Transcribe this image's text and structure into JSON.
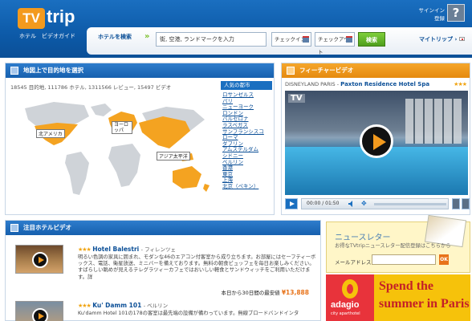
{
  "header": {
    "logo_tv": "TV",
    "logo_trip": "trip",
    "logo_sub": "ホテル　ビデオガイド",
    "signin": "サインイン",
    "register": "登録",
    "help": "?",
    "search_label": "ホテルを検索",
    "search_placeholder": "街, 空港, ランドマークを入力",
    "checkin": "チェックイン",
    "checkout": "チェックアウト",
    "search_button": "検索",
    "mytrip": "マイトリップ"
  },
  "map_panel": {
    "title": "地図上で目的地を選択",
    "stats": "18545 目的地, 111786 ホテル, 1311566 レビュー, 15497 ビデオ",
    "regions": [
      "北アメリカ",
      "ヨーロッパ",
      "アジア太平洋"
    ],
    "popular_heading": "人気の都市",
    "cities": [
      "ロサンゼルス",
      "パリ",
      "ニューヨーク",
      "ロンドン",
      "バルセロナ",
      "ラスベガス",
      "サンフランシスコ",
      "ローマ",
      "ダブリン",
      "アムステルダム",
      "シドニー",
      "ベルリン",
      "香港",
      "東京",
      "上海",
      "北京（ペキン）"
    ]
  },
  "video_panel": {
    "title": "フィーチャービデオ",
    "location": "DISNEYLAND PARIS",
    "hotel": "Paxton Residence Hotel Spa",
    "stars": "★★★",
    "watermark": "TV",
    "time": "00:00 / 01:50"
  },
  "featured": {
    "title": "注目ホテルビデオ",
    "hotels": [
      {
        "stars": "★★★",
        "name": "Hotel Balestri",
        "location": " - フィレンツェ",
        "description": "明るい色調の家具に囲まれ、モダンな46のエアコン付客室から成り立ちます。お部屋にはセーフティーボックス、電話、衛星放送、ミニバーを備えております。無料の朝食ビュッフェを毎日お楽しみください。すばらしい眺めが見えるテレグラツィーカフェではおいしい軽食とサンドウィッチをご利用いただけます。詳",
        "price_label": "本日から30日間の最安値",
        "price": "¥13,888"
      },
      {
        "stars": "★★★",
        "name": "Ku' Damm 101",
        "location": " - ベルリン",
        "description": "Ku'damm Hotel 101の178の客室は最先端の設備が備わっています。無線ブロードバンドインタ"
      }
    ]
  },
  "newsletter": {
    "title": "ニュースレター",
    "subtitle": "お得なTVtripニュースレター配信登録はこちらから",
    "email_label": "メールアドレス",
    "ok": "OK"
  },
  "ad": {
    "brand": "adagio",
    "brand_sub": "city aparthotel",
    "line1": "Spend the",
    "line2": "summer in Paris"
  }
}
